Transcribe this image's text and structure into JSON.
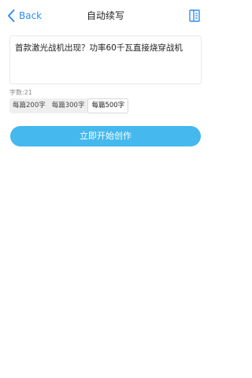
{
  "nav": {
    "back_label": "Back",
    "title": "自动续写",
    "icon": "panel-icon"
  },
  "editor": {
    "value": "首款激光战机出现？功率60千瓦直接烧穿战机"
  },
  "word_count": {
    "text": "字数:21"
  },
  "length_options": {
    "items": [
      {
        "label": "每篇200字",
        "selected": false
      },
      {
        "label": "每篇300字",
        "selected": false
      },
      {
        "label": "每篇500字",
        "selected": true
      }
    ]
  },
  "actions": {
    "start_label": "立即开始创作"
  },
  "colors": {
    "accent": "#2f8ef0",
    "cta": "#45b8ee"
  }
}
